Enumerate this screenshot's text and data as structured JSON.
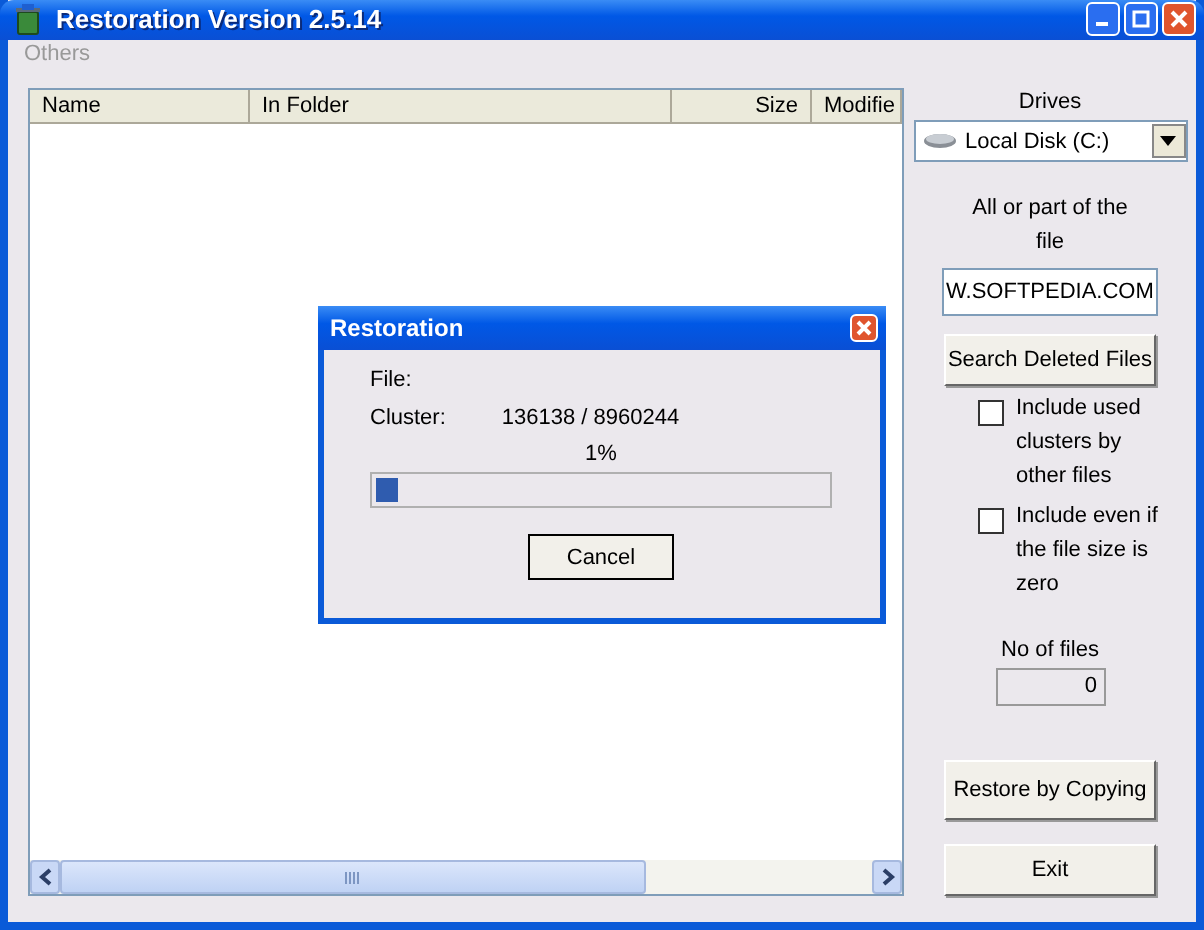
{
  "window": {
    "title": "Restoration Version 2.5.14"
  },
  "menu": [
    {
      "label": "Others"
    }
  ],
  "table": {
    "columns": [
      {
        "label": "Name"
      },
      {
        "label": "In Folder"
      },
      {
        "label": "Size"
      },
      {
        "label": "Modifie"
      }
    ]
  },
  "drives": {
    "label": "Drives",
    "value": "Local Disk (C:)"
  },
  "search": {
    "label": "All or part of the file",
    "value": "W.SOFTPEDIA.COM",
    "button": "Search Deleted Files"
  },
  "options": [
    {
      "label": "Include used clusters by other files",
      "checked": false
    },
    {
      "label": "Include even if the file size is zero",
      "checked": false
    }
  ],
  "files": {
    "label": "No of files",
    "value": "0"
  },
  "buttons": [
    "Restore by Copying",
    "Exit"
  ],
  "dialog": {
    "title": "Restoration",
    "file_label": "File:",
    "cluster_label": "Cluster:",
    "cluster_value": "136138 / 8960244",
    "percent": "1%",
    "level": 0.05,
    "button": "Cancel"
  }
}
